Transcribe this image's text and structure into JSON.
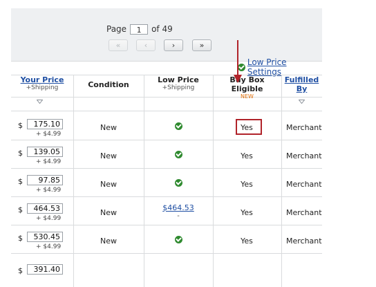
{
  "pagination": {
    "page_label": "Page",
    "page_value": "1",
    "of_label": "of 49",
    "first_label": "«",
    "prev_label": "‹",
    "next_label": "›",
    "last_label": "»"
  },
  "settings": {
    "link_label": "Low Price Settings"
  },
  "headers": {
    "your_price": "Your Price",
    "your_price_sub": "+Shipping",
    "condition": "Condition",
    "low_price": "Low Price",
    "low_price_sub": "+Shipping",
    "buy_box": "Buy Box Eligible",
    "buy_box_badge": "NEW",
    "fulfilled_1": "Fulfilled",
    "fulfilled_2": "By"
  },
  "rows": [
    {
      "currency": "$",
      "price": "175.10",
      "shipping": "+ $4.99",
      "condition": "New",
      "low_price_link": "",
      "low_price_dash": "",
      "buy_box": "Yes",
      "fulfilled": "Merchant"
    },
    {
      "currency": "$",
      "price": "139.05",
      "shipping": "+ $4.99",
      "condition": "New",
      "low_price_link": "",
      "low_price_dash": "",
      "buy_box": "Yes",
      "fulfilled": "Merchant"
    },
    {
      "currency": "$",
      "price": "97.85",
      "shipping": "+ $4.99",
      "condition": "New",
      "low_price_link": "",
      "low_price_dash": "",
      "buy_box": "Yes",
      "fulfilled": "Merchant"
    },
    {
      "currency": "$",
      "price": "464.53",
      "shipping": "+ $4.99",
      "condition": "New",
      "low_price_link": "$464.53",
      "low_price_dash": "-",
      "buy_box": "Yes",
      "fulfilled": "Merchant"
    },
    {
      "currency": "$",
      "price": "530.45",
      "shipping": "+ $4.99",
      "condition": "New",
      "low_price_link": "",
      "low_price_dash": "",
      "buy_box": "Yes",
      "fulfilled": "Merchant"
    },
    {
      "currency": "$",
      "price": "391.40",
      "shipping": "",
      "condition": "",
      "low_price_link": "",
      "low_price_dash": "",
      "buy_box": "",
      "fulfilled": ""
    }
  ],
  "colors": {
    "accent": "#b0232a",
    "link": "#1f4fa3",
    "check": "#2f8a2f",
    "badge": "#e2700a"
  }
}
